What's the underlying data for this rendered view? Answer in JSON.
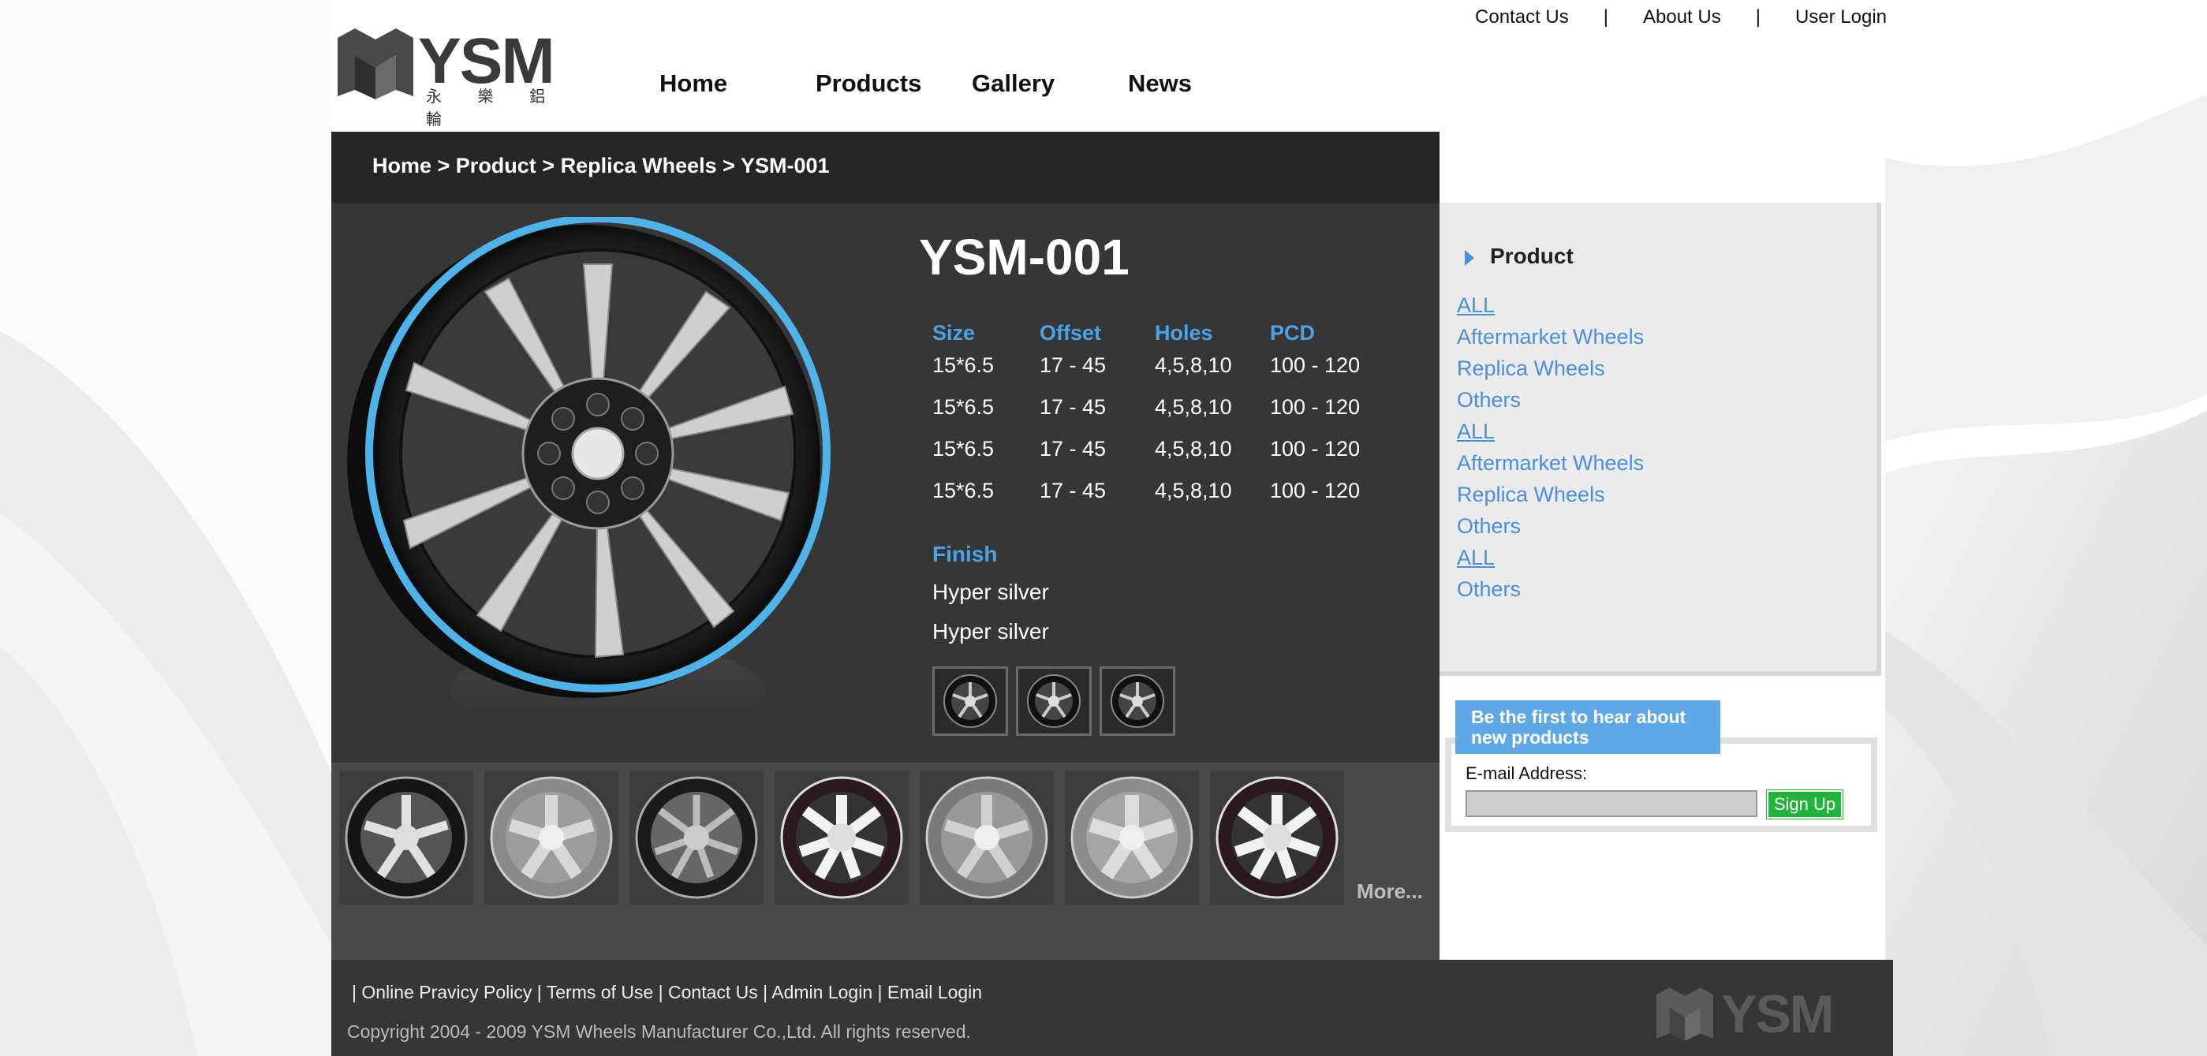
{
  "header": {
    "logo_text": "YSM",
    "logo_sub": "永 樂 鋁 輪",
    "top_links": [
      "Contact Us",
      "About Us",
      "User Login"
    ],
    "top_sep": "|",
    "nav": [
      "Home",
      "Products",
      "Gallery",
      "News"
    ]
  },
  "breadcrumb": [
    "Home",
    "Product",
    "Replica Wheels",
    "YSM-001"
  ],
  "breadcrumb_sep": " > ",
  "product": {
    "title": "YSM-001",
    "spec_headers": [
      "Size",
      "Offset",
      "Holes",
      "PCD"
    ],
    "spec_rows": [
      [
        "15*6.5",
        "17 - 45",
        "4,5,8,10",
        "100 - 120"
      ],
      [
        "15*6.5",
        "17 - 45",
        "4,5,8,10",
        "100 - 120"
      ],
      [
        "15*6.5",
        "17 - 45",
        "4,5,8,10",
        "100 - 120"
      ],
      [
        "15*6.5",
        "17 - 45",
        "4,5,8,10",
        "100 - 120"
      ]
    ],
    "finish_label": "Finish",
    "finishes": [
      "Hyper silver",
      "Hyper silver"
    ]
  },
  "strip": {
    "more_label": "More..."
  },
  "sidebar": {
    "title": "Product",
    "items": [
      {
        "label": "ALL",
        "underline": true
      },
      {
        "label": "Aftermarket Wheels",
        "underline": false
      },
      {
        "label": "Replica Wheels",
        "underline": false
      },
      {
        "label": "Others",
        "underline": false
      },
      {
        "label": "ALL",
        "underline": true
      },
      {
        "label": "Aftermarket Wheels",
        "underline": false
      },
      {
        "label": "Replica Wheels",
        "underline": false
      },
      {
        "label": "Others",
        "underline": false
      },
      {
        "label": "ALL",
        "underline": true
      },
      {
        "label": "Others",
        "underline": false
      }
    ]
  },
  "newsletter": {
    "tag": "Be the first to hear about new products",
    "email_label": "E-mail Address:",
    "email_value": "",
    "button": "Sign Up"
  },
  "footer": {
    "links": [
      "Online Pravicy Policy",
      "Terms of Use",
      "Contact Us",
      "Admin Login",
      "Email Login"
    ],
    "copyright": "Copyright 2004 - 2009 YSM Wheels Manufacturer Co.,Ltd. All rights reserved.",
    "logo_text": "YSM"
  },
  "colors": {
    "accent_blue": "#4aa3e8",
    "link_blue": "#4a90d9",
    "signup_green": "#22b33b",
    "panel_dark": "#363636"
  }
}
